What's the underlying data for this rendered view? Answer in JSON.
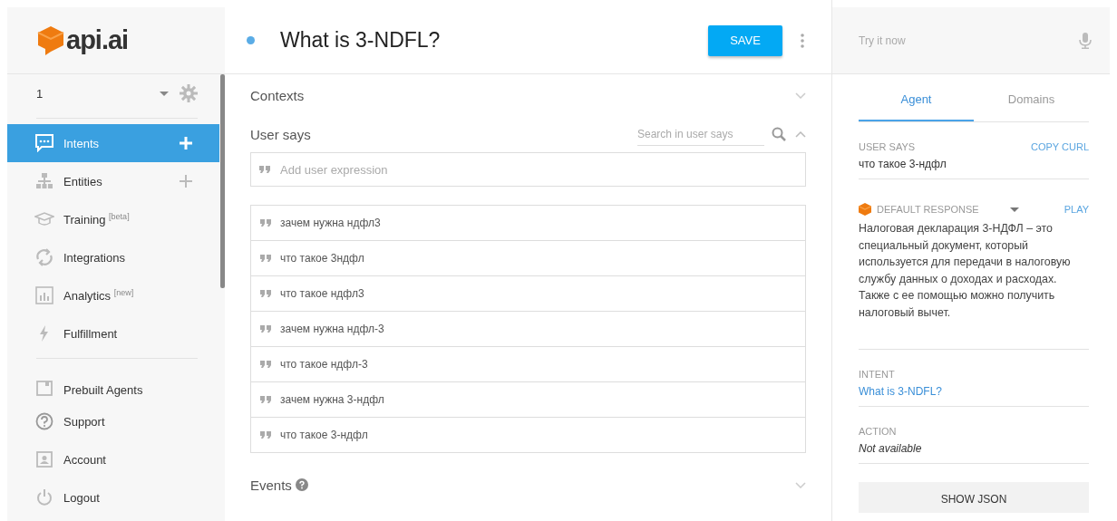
{
  "logo": {
    "text": "api.ai"
  },
  "agent": {
    "name": "1"
  },
  "sidebar": {
    "items": [
      {
        "label": "Intents",
        "selected": true,
        "add": true
      },
      {
        "label": "Entities",
        "selected": false,
        "add": true
      },
      {
        "label": "Training $^{[beta]}$",
        "selected": false,
        "add": false
      },
      {
        "label": "Integrations",
        "selected": false,
        "add": false
      },
      {
        "label": "Analytics $^{[new]}$",
        "selected": false,
        "add": false
      },
      {
        "label": "Fulfillment",
        "selected": false,
        "add": false
      }
    ],
    "prebuilt": {
      "label": "Prebuilt Agents"
    },
    "bottom_items": [
      {
        "label": "Support"
      },
      {
        "label": "Account"
      },
      {
        "label": "Logout"
      }
    ]
  },
  "intent": {
    "title": "What is 3-NDFL?",
    "save": "SAVE"
  },
  "sections": {
    "contexts": "Contexts",
    "user_says": "User says",
    "search_placeholder": "Search in user says",
    "add_placeholder": "Add user expression",
    "events": "Events"
  },
  "expressions": [
    "зачем нужна ндфл3",
    "что такое 3ндфл",
    "что такое ндфл3",
    "зачем нужна ндфл-3",
    "что такое ндфл-3",
    "зачем нужна 3-ндфл",
    "что такое 3-ндфл"
  ],
  "try": {
    "placeholder": "Try it now",
    "tabs": [
      {
        "label": "Agent",
        "selected": true
      },
      {
        "label": "Domains",
        "selected": false
      }
    ],
    "user_says_label": "USER SAYS",
    "copy_curl": "COPY CURL",
    "user_says": "что такое 3-ндфл",
    "response_label": "DEFAULT RESPONSE",
    "play": "PLAY",
    "response": "Налоговая декларация 3-НДФЛ – это специальный документ, который используется для передачи в налоговую службу данных о доходах и расходах. Также с ее помощью можно получить налоговый вычет.",
    "intent_label": "INTENT",
    "intent": "What is 3-NDFL?",
    "action_label": "ACTION",
    "action": "Not available",
    "show_json": "SHOW JSON"
  }
}
